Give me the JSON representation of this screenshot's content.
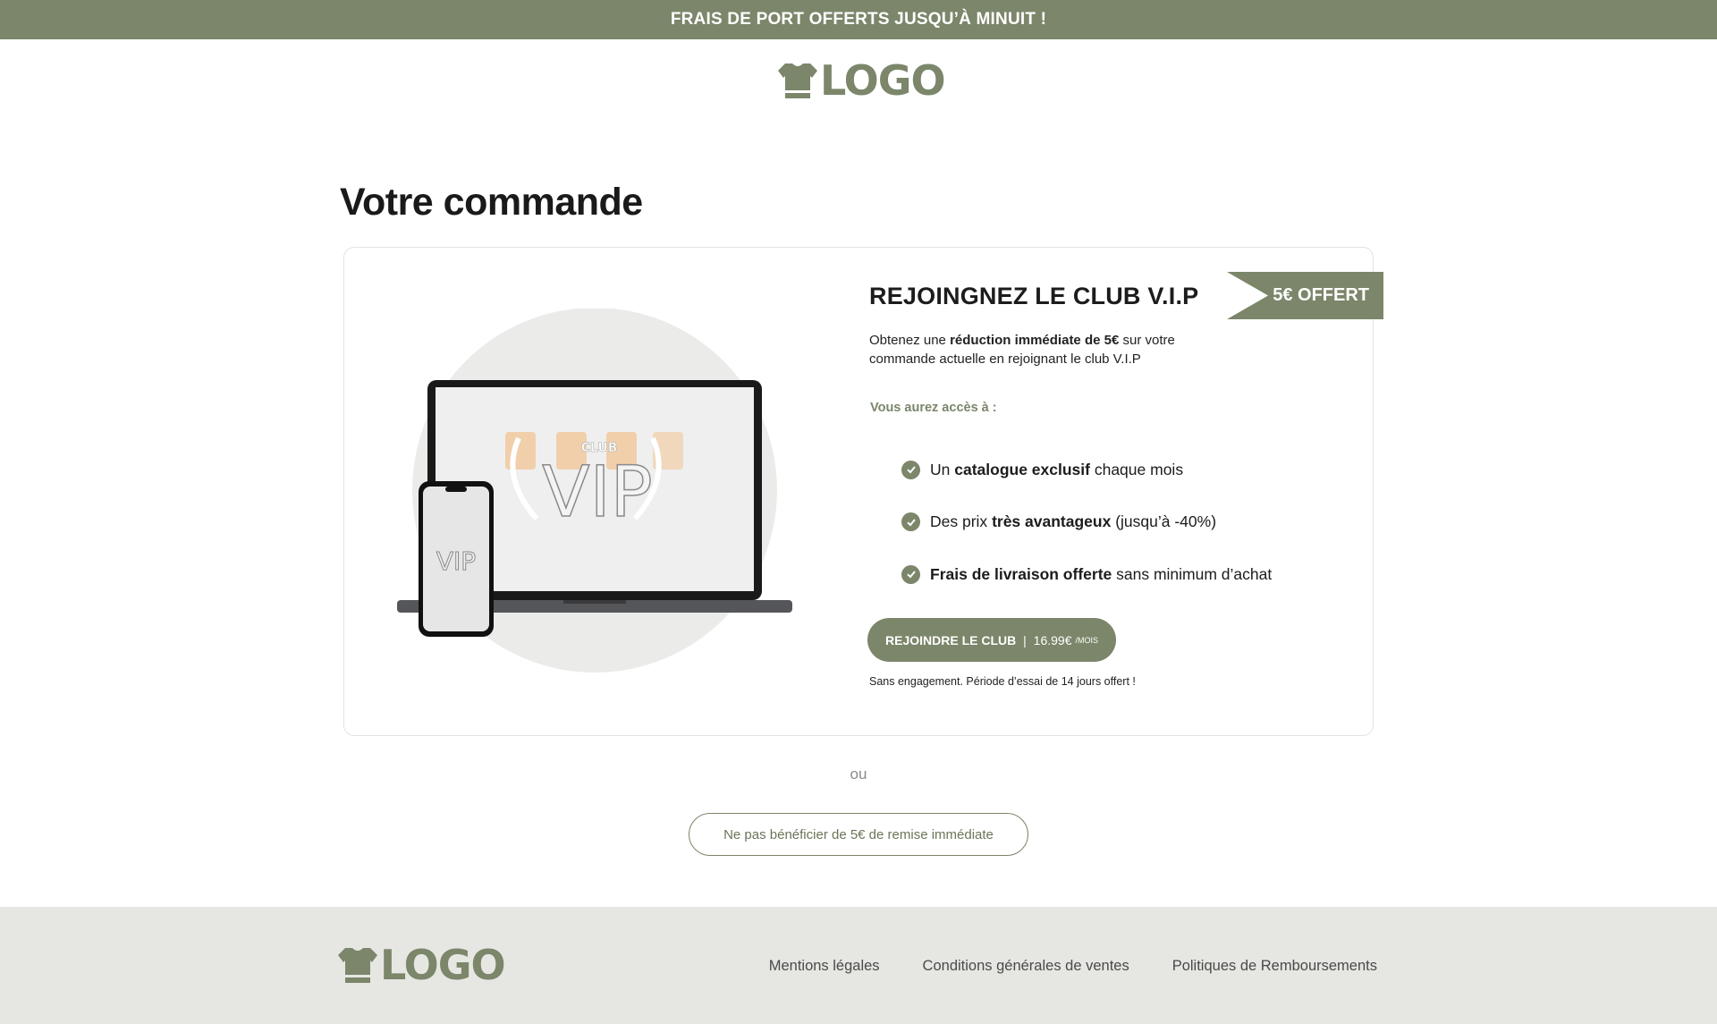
{
  "announcement": {
    "text": "FRAIS DE PORT OFFERTS JUSQU’À MINUIT !"
  },
  "brand": {
    "name": "LOGO",
    "color": "#7b866a"
  },
  "page": {
    "title": "Votre commande"
  },
  "vip_offer": {
    "badge": "5€ OFFERT",
    "title": "REJOINGNEZ LE CLUB V.I.P",
    "description_prefix": "Obtenez une ",
    "description_bold": "réduction immédiate de 5€",
    "description_suffix": " sur votre commande actuelle en rejoignant le club V.I.P",
    "access_label": "Vous aurez accès à :",
    "benefits": [
      {
        "pre": "Un ",
        "bold": "catalogue exclusif",
        "post": " chaque mois"
      },
      {
        "pre": "Des prix ",
        "bold": "très avantageux",
        "post": " (jusqu’à -40%)"
      },
      {
        "pre": "",
        "bold": "Frais de livraison offerte",
        "post": " sans minimum d’achat"
      }
    ],
    "cta": {
      "label": "REJOINDRE LE CLUB",
      "separator": " | ",
      "price": "16.99€",
      "period": "/MOIS"
    },
    "fine_print": "Sans engagement. Période d’essai de 14 jours offert !",
    "illustration": {
      "club_text": "CLUB",
      "vip_text": "VIP"
    }
  },
  "separator_text": "ou",
  "decline_button": "Ne pas bénéficier de 5€ de remise immédiate",
  "footer": {
    "links": [
      "Mentions légales",
      "Conditions générales de ventes",
      "Politiques de Remboursements"
    ]
  },
  "colors": {
    "accent": "#7b866a",
    "footer_bg": "#e6e7e2",
    "text": "#1c1c1c"
  },
  "icons": [
    "tshirt-icon",
    "check-icon"
  ]
}
